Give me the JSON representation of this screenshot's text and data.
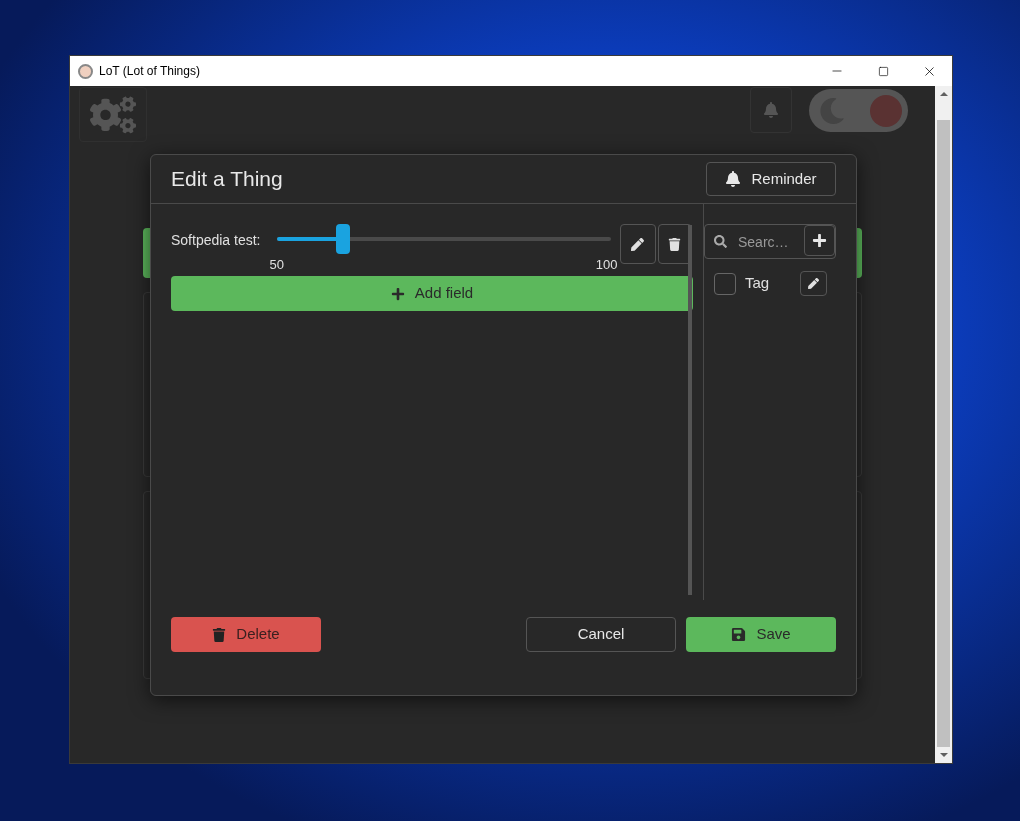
{
  "window": {
    "title": "LoT (Lot of Things)"
  },
  "toolbar": {
    "dark_mode": {
      "on": true
    }
  },
  "dialog": {
    "title": "Edit a Thing",
    "reminder_button": "Reminder",
    "fields": [
      {
        "label": "Softpedia test:",
        "level": 0.2,
        "min": "50",
        "max": "100"
      }
    ],
    "add_field_button": "Add field",
    "tag_search": {
      "placeholder": "Searc…"
    },
    "tags": [
      {
        "label": "Tag",
        "checked": false
      }
    ],
    "buttons": {
      "delete": "Delete",
      "cancel": "Cancel",
      "save": "Save"
    }
  }
}
